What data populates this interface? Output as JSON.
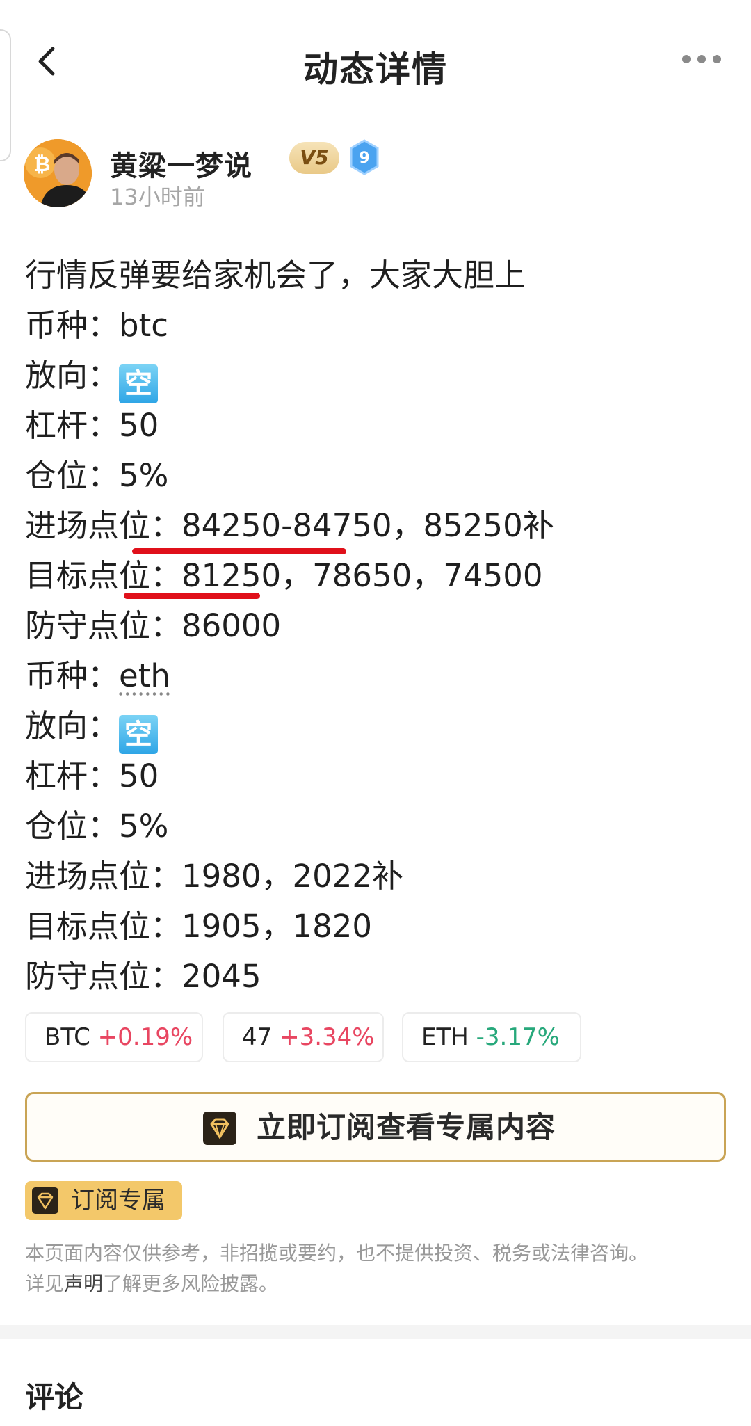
{
  "header": {
    "title": "动态详情"
  },
  "author": {
    "name": "黄粱一梦说",
    "vip_badge": "V5",
    "level": "9",
    "time": "13小时前"
  },
  "post": {
    "lines": [
      "行情反弹要给家机会了，大家大胆上",
      "币种：btc",
      "放向：",
      "杠杆：50",
      "仓位：5%",
      "进场点位：84250-84750，85250补",
      "目标点位：81250，78650，74500",
      "防守点位：86000",
      "币种：",
      "放向：",
      "杠杆：50",
      "仓位：5%",
      "进场点位：1980，2022补",
      "目标点位：1905，1820",
      "防守点位：2045"
    ],
    "eth_word": "eth",
    "direction_box": "空"
  },
  "tickers": [
    {
      "symbol": "BTC",
      "change": "+0.19%"
    },
    {
      "symbol": "47",
      "change": "+3.34%"
    },
    {
      "symbol": "ETH",
      "change": "-3.17%"
    }
  ],
  "subscribe": {
    "label": "立即订阅查看专属内容"
  },
  "exclusive_tag": {
    "label": "订阅专属"
  },
  "disclaimer": {
    "text1": "本页面内容仅供参考，非招揽或要约，也不提供投资、税务或法律咨询。",
    "text2_pre": "详见",
    "text2_link": "声明",
    "text2_post": "了解更多风险披露。"
  },
  "comments": {
    "title": "评论"
  },
  "colors": {
    "up": "#e84661",
    "down": "#27a87b",
    "gold": "#c9a455",
    "underline": "#e0101a"
  }
}
